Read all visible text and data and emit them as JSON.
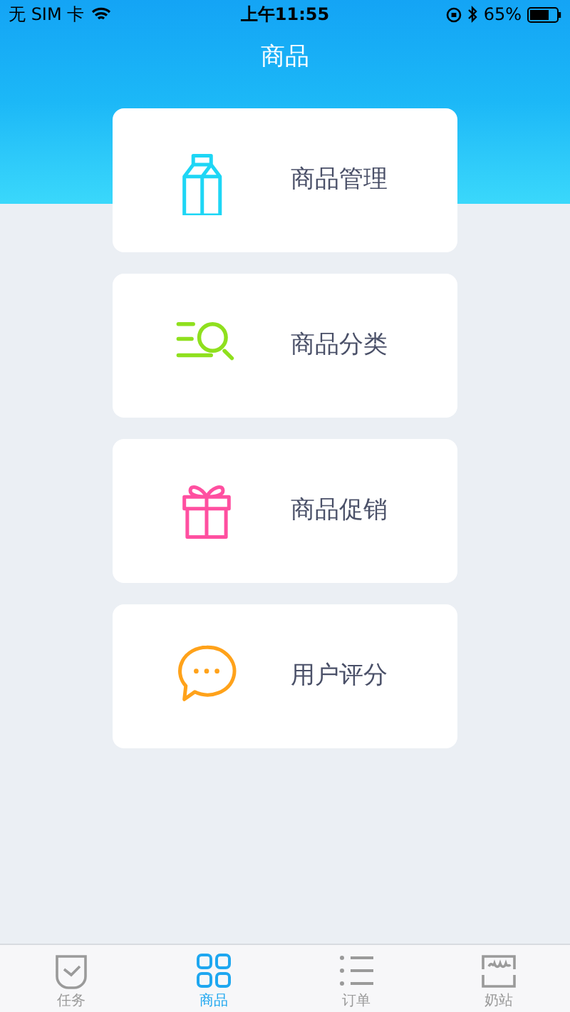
{
  "status_bar": {
    "carrier": "无 SIM 卡",
    "time": "上午11:55",
    "battery": "65%"
  },
  "header": {
    "title": "商品"
  },
  "menu": [
    {
      "kind": "carton",
      "label": "商品管理",
      "color": "#1ed6f5"
    },
    {
      "kind": "search-list",
      "label": "商品分类",
      "color": "#8fe01e"
    },
    {
      "kind": "gift",
      "label": "商品促销",
      "color": "#ff4fa0"
    },
    {
      "kind": "chat",
      "label": "用户评分",
      "color": "#ffa21a"
    }
  ],
  "tab_bar": [
    {
      "kind": "task",
      "label": "任务",
      "selected": false
    },
    {
      "kind": "grid",
      "label": "商品",
      "selected": true
    },
    {
      "kind": "list",
      "label": "订单",
      "selected": false
    },
    {
      "kind": "station",
      "label": "奶站",
      "selected": false
    }
  ]
}
